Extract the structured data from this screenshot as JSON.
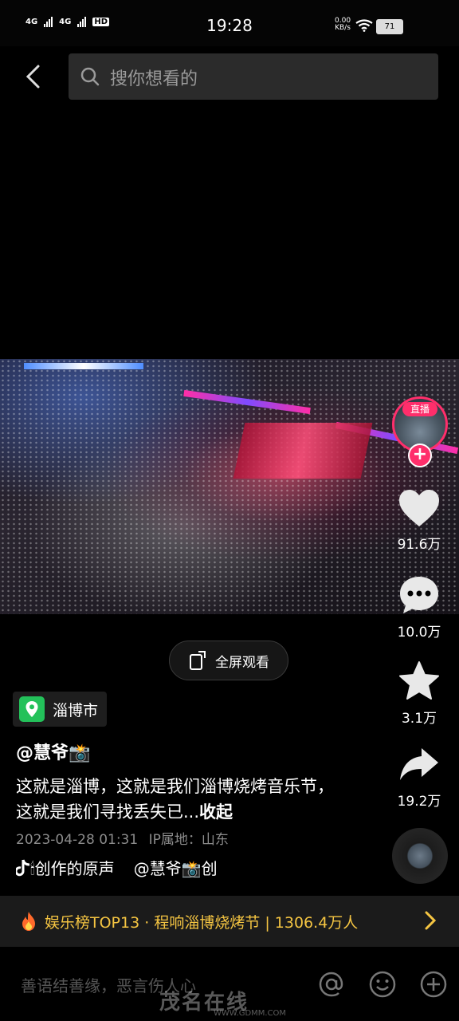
{
  "status": {
    "net1": "4G",
    "net2": "4G",
    "hd": "HD",
    "time": "19:28",
    "speed_value": "0.00",
    "speed_unit": "KB/s",
    "battery": "71"
  },
  "search": {
    "placeholder": "搜你想看的"
  },
  "video": {
    "fullscreen_label": "全屏观看"
  },
  "creator": {
    "live_tag": "直播",
    "follow": "+"
  },
  "actions": {
    "likes": "91.6万",
    "comments": "10.0万",
    "favorites": "3.1万",
    "shares": "19.2万"
  },
  "post": {
    "location": "淄博市",
    "author": "@慧爷📸",
    "description": "这就是淄博，这就是我们淄博烧烤音乐节，这就是我们寻找丢失已...",
    "collapse": "收起",
    "date": "2023-04-28 01:31",
    "ip_label": "IP属地：山东",
    "music_left": "🕯创作的原声",
    "music_right": "@慧爷📸创"
  },
  "hotbar": {
    "text": "娱乐榜TOP13 · 程响淄博烧烤节 | 1306.4万人"
  },
  "comment": {
    "placeholder": "善语结善缘，恶言伤人心"
  },
  "watermark": {
    "text": "茂名在线",
    "url": "WWW.GDMM.COM"
  },
  "colors": {
    "accent": "#ff2e6b",
    "hot": "#f5c542",
    "background": "#000000"
  }
}
